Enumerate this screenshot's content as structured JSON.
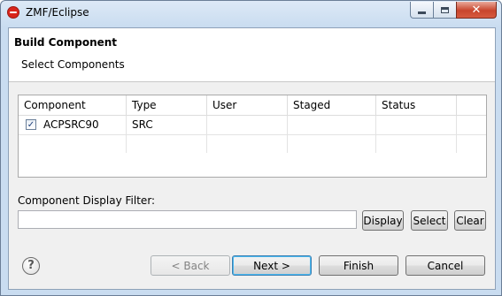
{
  "window": {
    "title": "ZMF/Eclipse"
  },
  "header": {
    "title": "Build Component",
    "subtitle": "Select Components"
  },
  "table": {
    "columns": [
      "Component",
      "Type",
      "User",
      "Staged",
      "Status"
    ],
    "rows": [
      {
        "checked": true,
        "component": "ACPSRC90",
        "type": "SRC",
        "user": "",
        "staged": "",
        "status": ""
      }
    ]
  },
  "filter": {
    "label": "Component Display Filter:",
    "value": "",
    "display_label": "Display",
    "select_label": "Select",
    "clear_label": "Clear"
  },
  "footer": {
    "help_glyph": "?",
    "back_label": "< Back",
    "next_label": "Next >",
    "finish_label": "Finish",
    "cancel_label": "Cancel"
  },
  "icons": {
    "app": "eclipse-red-circle-icon",
    "help": "help-question-icon"
  }
}
